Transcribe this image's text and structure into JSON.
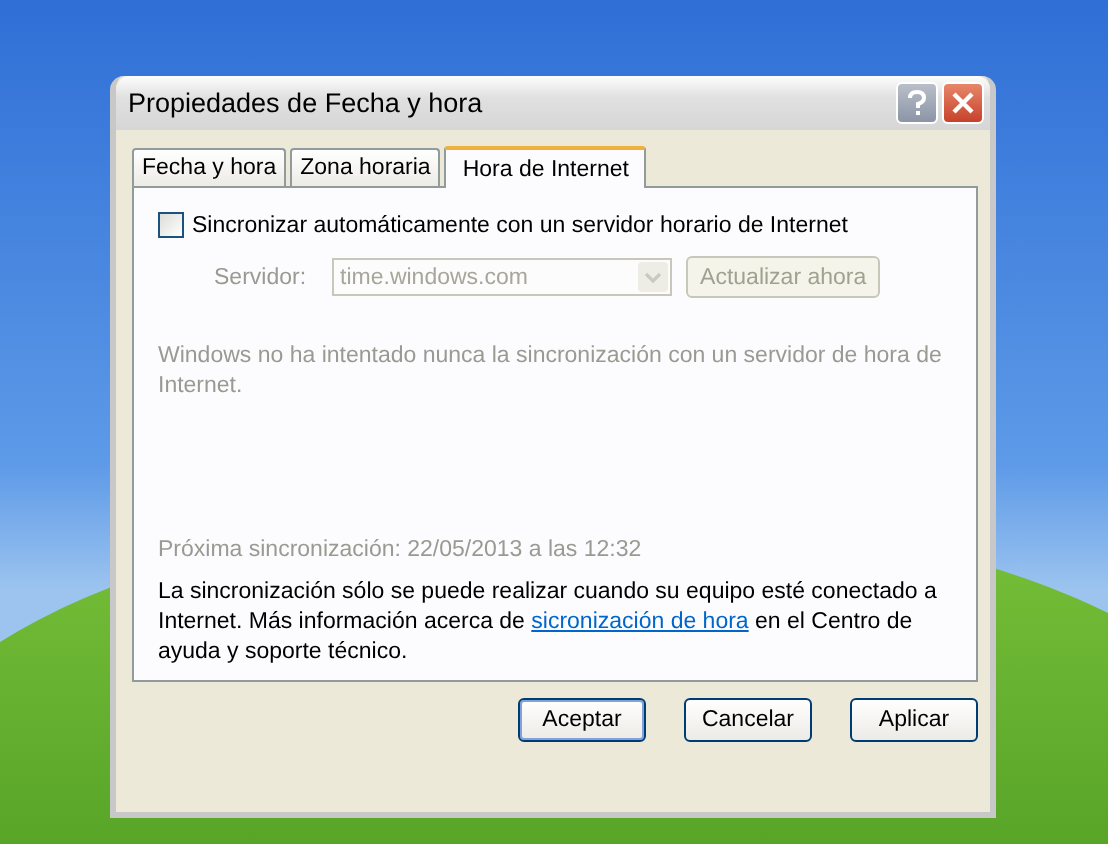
{
  "window": {
    "title": "Propiedades de Fecha y hora"
  },
  "tabs": [
    {
      "label": "Fecha y hora",
      "selected": false
    },
    {
      "label": "Zona horaria",
      "selected": false
    },
    {
      "label": "Hora de Internet",
      "selected": true
    }
  ],
  "auto_sync": {
    "label": "Sincronizar automáticamente con un servidor horario de Internet",
    "checked": false
  },
  "server": {
    "label": "Servidor:",
    "value": "time.windows.com",
    "disabled": true
  },
  "update_button": {
    "label": "Actualizar ahora",
    "disabled": true
  },
  "status_text": "Windows no ha intentado nunca la sincronización con un servidor de hora de Internet.",
  "next_sync": "Próxima sincronización: 22/05/2013 a las 12:32",
  "info": {
    "text_before": "La sincronización sólo se puede realizar cuando su equipo esté conectado a Internet. Más información acerca de ",
    "link": "sicronización de hora",
    "text_after": " en el Centro de ayuda y soporte técnico."
  },
  "buttons": [
    {
      "label": "Aceptar",
      "default": true
    },
    {
      "label": "Cancelar",
      "default": false
    },
    {
      "label": "Aplicar",
      "default": false
    }
  ]
}
